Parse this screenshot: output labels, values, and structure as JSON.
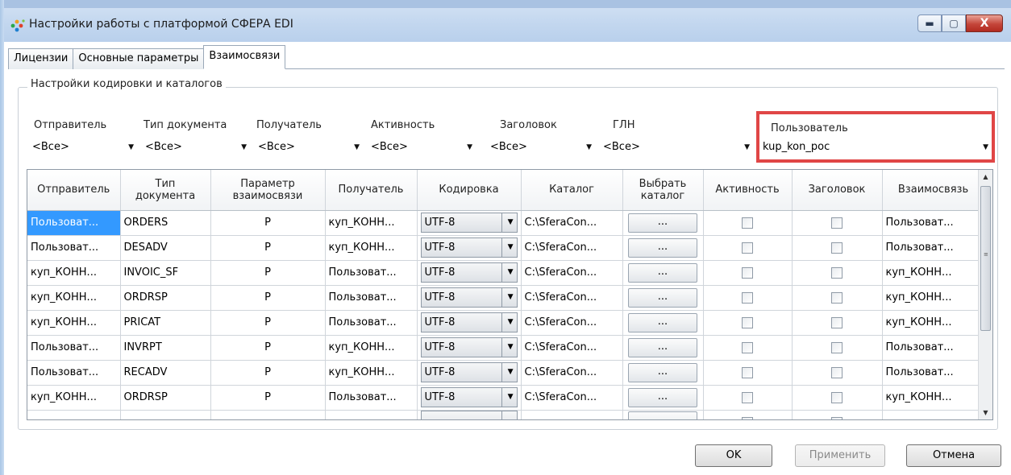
{
  "window": {
    "title": "Настройки работы с платформой СФЕРА EDI",
    "minimize": "▬",
    "maximize": "▢",
    "close": "X"
  },
  "tabs": [
    "Лицензии",
    "Основные параметры",
    "Взаимосвязи"
  ],
  "active_tab": "Взаимосвязи",
  "group": {
    "title": "Настройки кодировки и каталогов"
  },
  "filters": [
    {
      "label": "Отправитель",
      "value": "<Все>"
    },
    {
      "label": "Тип документа",
      "value": "<Все>"
    },
    {
      "label": "Получатель",
      "value": "<Все>"
    },
    {
      "label": "Активность",
      "value": "<Все>"
    },
    {
      "label": "Заголовок",
      "value": "<Все>"
    },
    {
      "label": "ГЛН",
      "value": "<Все>"
    },
    {
      "label": "Пользователь",
      "value": "kup_kon_poc"
    }
  ],
  "grid": {
    "headers": [
      "Отправитель",
      "Тип документа",
      "Параметр взаимосвязи",
      "Получатель",
      "Кодировка",
      "Каталог",
      "Выбрать каталог",
      "Активность",
      "Заголовок",
      "Взаимосвязь"
    ],
    "rows": [
      {
        "sender": "Пользоват...",
        "doc": "ORDERS",
        "param": "P",
        "recipient": "куп_КОНН...",
        "enc": "UTF-8",
        "catalog": "C:\\SferaCon...",
        "choose": "...",
        "link": "Пользоват..."
      },
      {
        "sender": "Пользоват...",
        "doc": "DESADV",
        "param": "P",
        "recipient": "куп_КОНН...",
        "enc": "UTF-8",
        "catalog": "C:\\SferaCon...",
        "choose": "...",
        "link": "Пользоват..."
      },
      {
        "sender": "куп_КОНН...",
        "doc": "INVOIC_SF",
        "param": "P",
        "recipient": "Пользоват...",
        "enc": "UTF-8",
        "catalog": "C:\\SferaCon...",
        "choose": "...",
        "link": "куп_КОНН..."
      },
      {
        "sender": "куп_КОНН...",
        "doc": "ORDRSP",
        "param": "P",
        "recipient": "Пользоват...",
        "enc": "UTF-8",
        "catalog": "C:\\SferaCon...",
        "choose": "...",
        "link": "куп_КОНН..."
      },
      {
        "sender": "куп_КОНН...",
        "doc": "PRICAT",
        "param": "P",
        "recipient": "Пользоват...",
        "enc": "UTF-8",
        "catalog": "C:\\SferaCon...",
        "choose": "...",
        "link": "куп_КОНН..."
      },
      {
        "sender": "Пользоват...",
        "doc": "INVRPT",
        "param": "P",
        "recipient": "куп_КОНН...",
        "enc": "UTF-8",
        "catalog": "C:\\SferaCon...",
        "choose": "...",
        "link": "Пользоват..."
      },
      {
        "sender": "Пользоват...",
        "doc": "RECADV",
        "param": "P",
        "recipient": "куп_КОНН...",
        "enc": "UTF-8",
        "catalog": "C:\\SferaCon...",
        "choose": "...",
        "link": "Пользоват..."
      },
      {
        "sender": "куп_КОНН...",
        "doc": "ORDRSP",
        "param": "P",
        "recipient": "Пользоват...",
        "enc": "UTF-8",
        "catalog": "C:\\SferaCon...",
        "choose": "...",
        "link": "куп_КОНН..."
      },
      {
        "sender": "",
        "doc": "",
        "param": "",
        "recipient": "",
        "enc": "",
        "catalog": "",
        "choose": "",
        "link": ""
      }
    ]
  },
  "buttons": {
    "ok": "OK",
    "apply": "Применить",
    "cancel": "Отмена"
  },
  "icons": {
    "dropdown": "▼",
    "scroll_up": "▲",
    "scroll_down": "▼",
    "grip": "≡"
  },
  "colors": {
    "selection": "#3399ff",
    "highlight_box": "#e04646"
  }
}
